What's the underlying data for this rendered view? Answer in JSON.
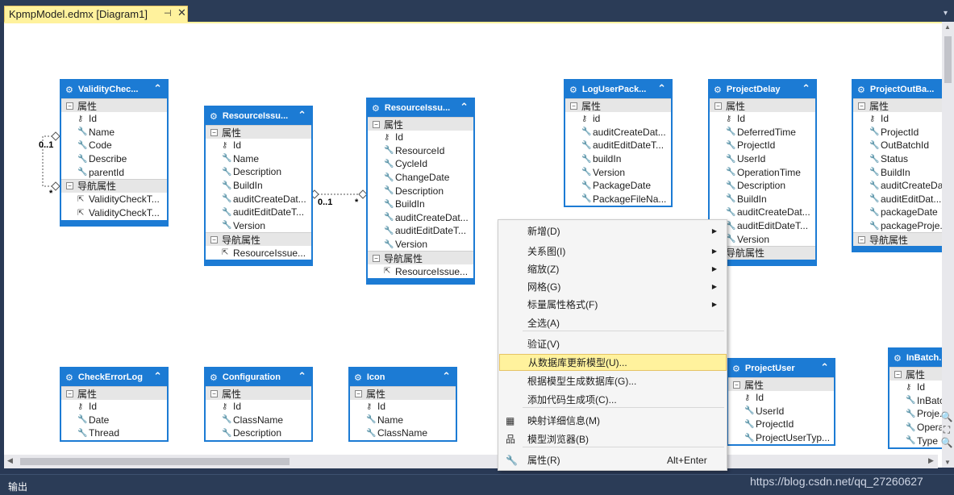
{
  "tab": {
    "title": "KpmpModel.edmx [Diagram1]",
    "pin": "⊣",
    "close": "✕",
    "overflow": "▾"
  },
  "connector_labels": {
    "a_mult1": "0..1",
    "a_mult2": "*",
    "b_mult1": "0..1",
    "b_mult2": "*"
  },
  "section_labels": {
    "props": "属性",
    "nav": "导航属性"
  },
  "entities": [
    {
      "name": "ValidityChec...",
      "props": [
        "Id",
        "Name",
        "Code",
        "Describe",
        "parentId"
      ],
      "nav": [
        "ValidityCheckT...",
        "ValidityCheckT..."
      ]
    },
    {
      "name": "ResourceIssu...",
      "props": [
        "Id",
        "Name",
        "Description",
        "BuildIn",
        "auditCreateDat...",
        "auditEditDateT...",
        "Version"
      ],
      "nav": [
        "ResourceIssue..."
      ]
    },
    {
      "name": "ResourceIssu...",
      "props": [
        "Id",
        "ResourceId",
        "CycleId",
        "ChangeDate",
        "Description",
        "BuildIn",
        "auditCreateDat...",
        "auditEditDateT...",
        "Version"
      ],
      "nav": [
        "ResourceIssue..."
      ]
    },
    {
      "name": "LogUserPack...",
      "props": [
        "id",
        "auditCreateDat...",
        "auditEditDateT...",
        "buildIn",
        "Version",
        "PackageDate",
        "PackageFileNa..."
      ],
      "nav": []
    },
    {
      "name": "ProjectDelay",
      "props": [
        "Id",
        "DeferredTime",
        "ProjectId",
        "UserId",
        "OperationTime",
        "Description",
        "BuildIn",
        "auditCreateDat...",
        "auditEditDateT...",
        "Version"
      ],
      "nav": []
    },
    {
      "name": "ProjectOutBa...",
      "props": [
        "Id",
        "ProjectId",
        "OutBatchId",
        "Status",
        "BuildIn",
        "auditCreateDa...",
        "auditEditDat...",
        "packageDate",
        "packageProje..."
      ],
      "nav": []
    },
    {
      "name": "CheckErrorLog",
      "props": [
        "Id",
        "Date",
        "Thread"
      ],
      "nav": []
    },
    {
      "name": "Configuration",
      "props": [
        "Id",
        "ClassName",
        "Description"
      ],
      "nav": []
    },
    {
      "name": "Icon",
      "props": [
        "Id",
        "Name",
        "ClassName"
      ],
      "nav": []
    },
    {
      "name": "ProjectUser",
      "props": [
        "Id",
        "UserId",
        "ProjectId",
        "ProjectUserTyp..."
      ],
      "nav": []
    },
    {
      "name": "InBatch...",
      "props": [
        "Id",
        "InBatc...",
        "Proje...",
        "Opera...",
        "Type"
      ],
      "nav": []
    }
  ],
  "context_menu": [
    {
      "label": "新增(D)",
      "submenu": true
    },
    {
      "label": "关系图(I)",
      "submenu": true
    },
    {
      "label": "缩放(Z)",
      "submenu": true
    },
    {
      "label": "网格(G)",
      "submenu": true
    },
    {
      "label": "标量属性格式(F)",
      "submenu": true
    },
    {
      "label": "全选(A)"
    },
    {
      "label": "验证(V)"
    },
    {
      "label": "从数据库更新模型(U)...",
      "highlighted": true
    },
    {
      "label": "根据模型生成数据库(G)..."
    },
    {
      "label": "添加代码生成项(C)..."
    },
    {
      "label": "映射详细信息(M)",
      "icon": "mapping-icon"
    },
    {
      "label": "模型浏览器(B)",
      "icon": "model-browser-icon"
    },
    {
      "label": "属性(R)",
      "shortcut": "Alt+Enter",
      "icon": "properties-wrench-icon"
    }
  ],
  "output_panel": {
    "title": "输出"
  },
  "watermark": "https://blog.csdn.net/qq_27260627",
  "colors": {
    "entity_header": "#1c7bd4",
    "menu_highlight": "#fff29d",
    "chrome": "#293955"
  }
}
